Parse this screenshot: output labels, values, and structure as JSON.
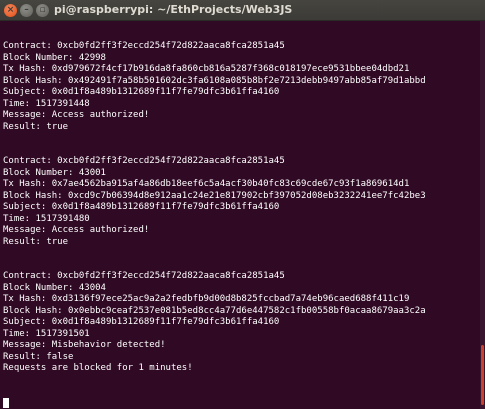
{
  "window": {
    "title": "pi@raspberrypi: ~/EthProjects/Web3JS",
    "close_glyph": "×",
    "min_glyph": "–",
    "max_glyph": "▫"
  },
  "blocks": [
    {
      "lines": [
        "Contract: 0xcb0fd2ff3f2eccd254f72d822aaca8fca2851a45",
        "Block Number: 42998",
        "Tx Hash: 0xd979672f4cf17b916da8fa860cb816a5287f368c018197ece9531bbee04dbd21",
        "Block Hash: 0x492491f7a58b501602dc3fa6108a085b8bf2e7213debb9497abb85af79d1abbd",
        "Subject: 0x0d1f8a489b1312689f11f7fe79dfc3b61ffa4160",
        "Time: 1517391448",
        "Message: Access authorized!",
        "Result: true"
      ]
    },
    {
      "lines": [
        "Contract: 0xcb0fd2ff3f2eccd254f72d822aaca8fca2851a45",
        "Block Number: 43001",
        "Tx Hash: 0x7ae4562ba915af4a86db18eef6c5a4acf30b40fc83c69cde67c93f1a869614d1",
        "Block Hash: 0xcd9c7b06394d8e912aa1c24e21e817902cbf397052d08eb3232241ee7fc42be3",
        "Subject: 0x0d1f8a489b1312689f11f7fe79dfc3b61ffa4160",
        "Time: 1517391480",
        "Message: Access authorized!",
        "Result: true"
      ]
    },
    {
      "lines": [
        "Contract: 0xcb0fd2ff3f2eccd254f72d822aaca8fca2851a45",
        "Block Number: 43004",
        "Tx Hash: 0xd3136f97ece25ac9a2a2fedbfb9d00d8b825fccbad7a74eb96caed688f411c19",
        "Block Hash: 0x0ebbc9ceaf2537e081b5ed8cc4a77d6e447582c1fb00558bf0acaa8679aa3c2a",
        "Subject: 0x0d1f8a489b1312689f11f7fe79dfc3b61ffa4160",
        "Time: 1517391501",
        "Message: Misbehavior detected!",
        "Result: false",
        "Requests are blocked for 1 minutes!"
      ]
    }
  ]
}
